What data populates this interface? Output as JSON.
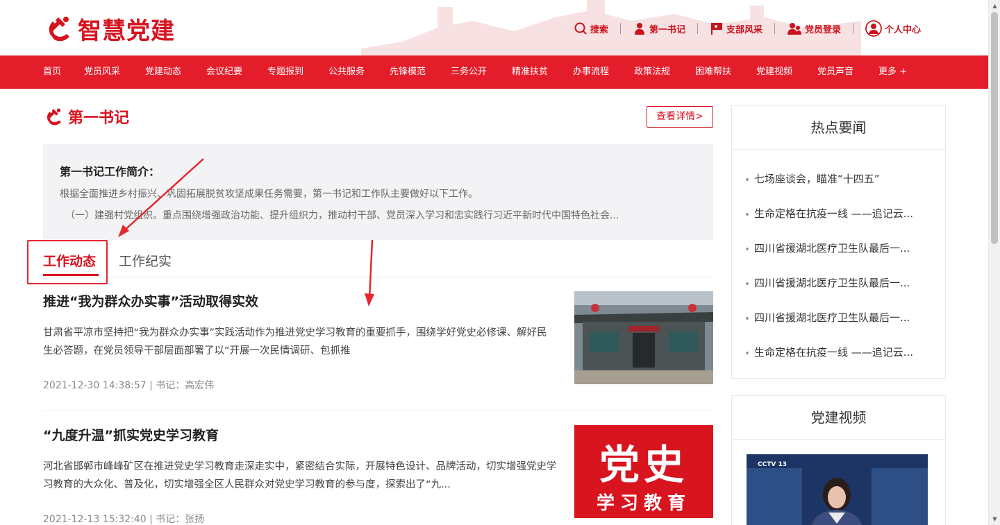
{
  "header": {
    "logo_text": "智慧党建",
    "links": [
      {
        "label": "搜索",
        "icon": "search-icon"
      },
      {
        "label": "第一书记",
        "icon": "person-icon"
      },
      {
        "label": "支部风采",
        "icon": "flag-icon"
      },
      {
        "label": "党员登录",
        "icon": "users-icon"
      },
      {
        "label": "个人中心",
        "icon": "user-circle-icon"
      }
    ]
  },
  "nav": {
    "items": [
      "首页",
      "党员风采",
      "党建动态",
      "会议纪要",
      "专题报到",
      "公共服务",
      "先锋模范",
      "三务公开",
      "精准扶贫",
      "办事流程",
      "政策法规",
      "困难帮扶",
      "党建视频",
      "党员声音",
      "更多 +"
    ]
  },
  "section": {
    "title": "第一书记",
    "detail_button": "查看详情>"
  },
  "intro": {
    "title": "第一书记工作简介：",
    "line1": "根据全面推进乡村振兴、巩固拓展脱贫攻坚成果任务需要，第一书记和工作队主要做好以下工作。",
    "line2": "（一）建强村党组织。重点围绕增强政治功能、提升组织力，推动村干部、党员深入学习和忠实践行习近平新时代中国特色社会..."
  },
  "tabs": {
    "active": "工作动态",
    "other": "工作纪实"
  },
  "news": [
    {
      "title": "推进“我为群众办实事”活动取得实效",
      "summary": "甘肃省平凉市坚持把“我为群众办实事”实践活动作为推进党史学习教育的重要抓手，围绕学好党史必修课、解好民生必答题，在党员领导干部层面部署了以“开展一次民情调研、包抓推",
      "meta": "2021-12-30 14:38:57 | 书记：高宏伟"
    },
    {
      "title": "“九度升温”抓实党史学习教育",
      "summary": "河北省邯郸市峰峰矿区在推进党史学习教育走深走实中，紧密结合实际，开展特色设计、品牌活动，切实增强党史学习教育的大众化、普及化，切实增强全区人民群众对党史学习教育的参与度，探索出了“九...",
      "meta": "2021-12-13 15:32:40 | 书记：张扬",
      "image_text_1": "党史",
      "image_text_2": "学习教育"
    }
  ],
  "hot_news": {
    "title": "热点要闻",
    "items": [
      "七场座谈会，瞄准“十四五”",
      "生命定格在抗疫一线 ——追记云...",
      "四川省援湖北医疗卫生队最后一...",
      "四川省援湖北医疗卫生队最后一...",
      "四川省援湖北医疗卫生队最后一...",
      "生命定格在抗疫一线 ——追记云..."
    ]
  },
  "video_panel": {
    "title": "党建视频",
    "thumb_channel": "CCTV 13"
  },
  "colors": {
    "brand_red": "#e41d2b",
    "title_red": "#d7131f",
    "annotation_red": "#e4262e"
  }
}
